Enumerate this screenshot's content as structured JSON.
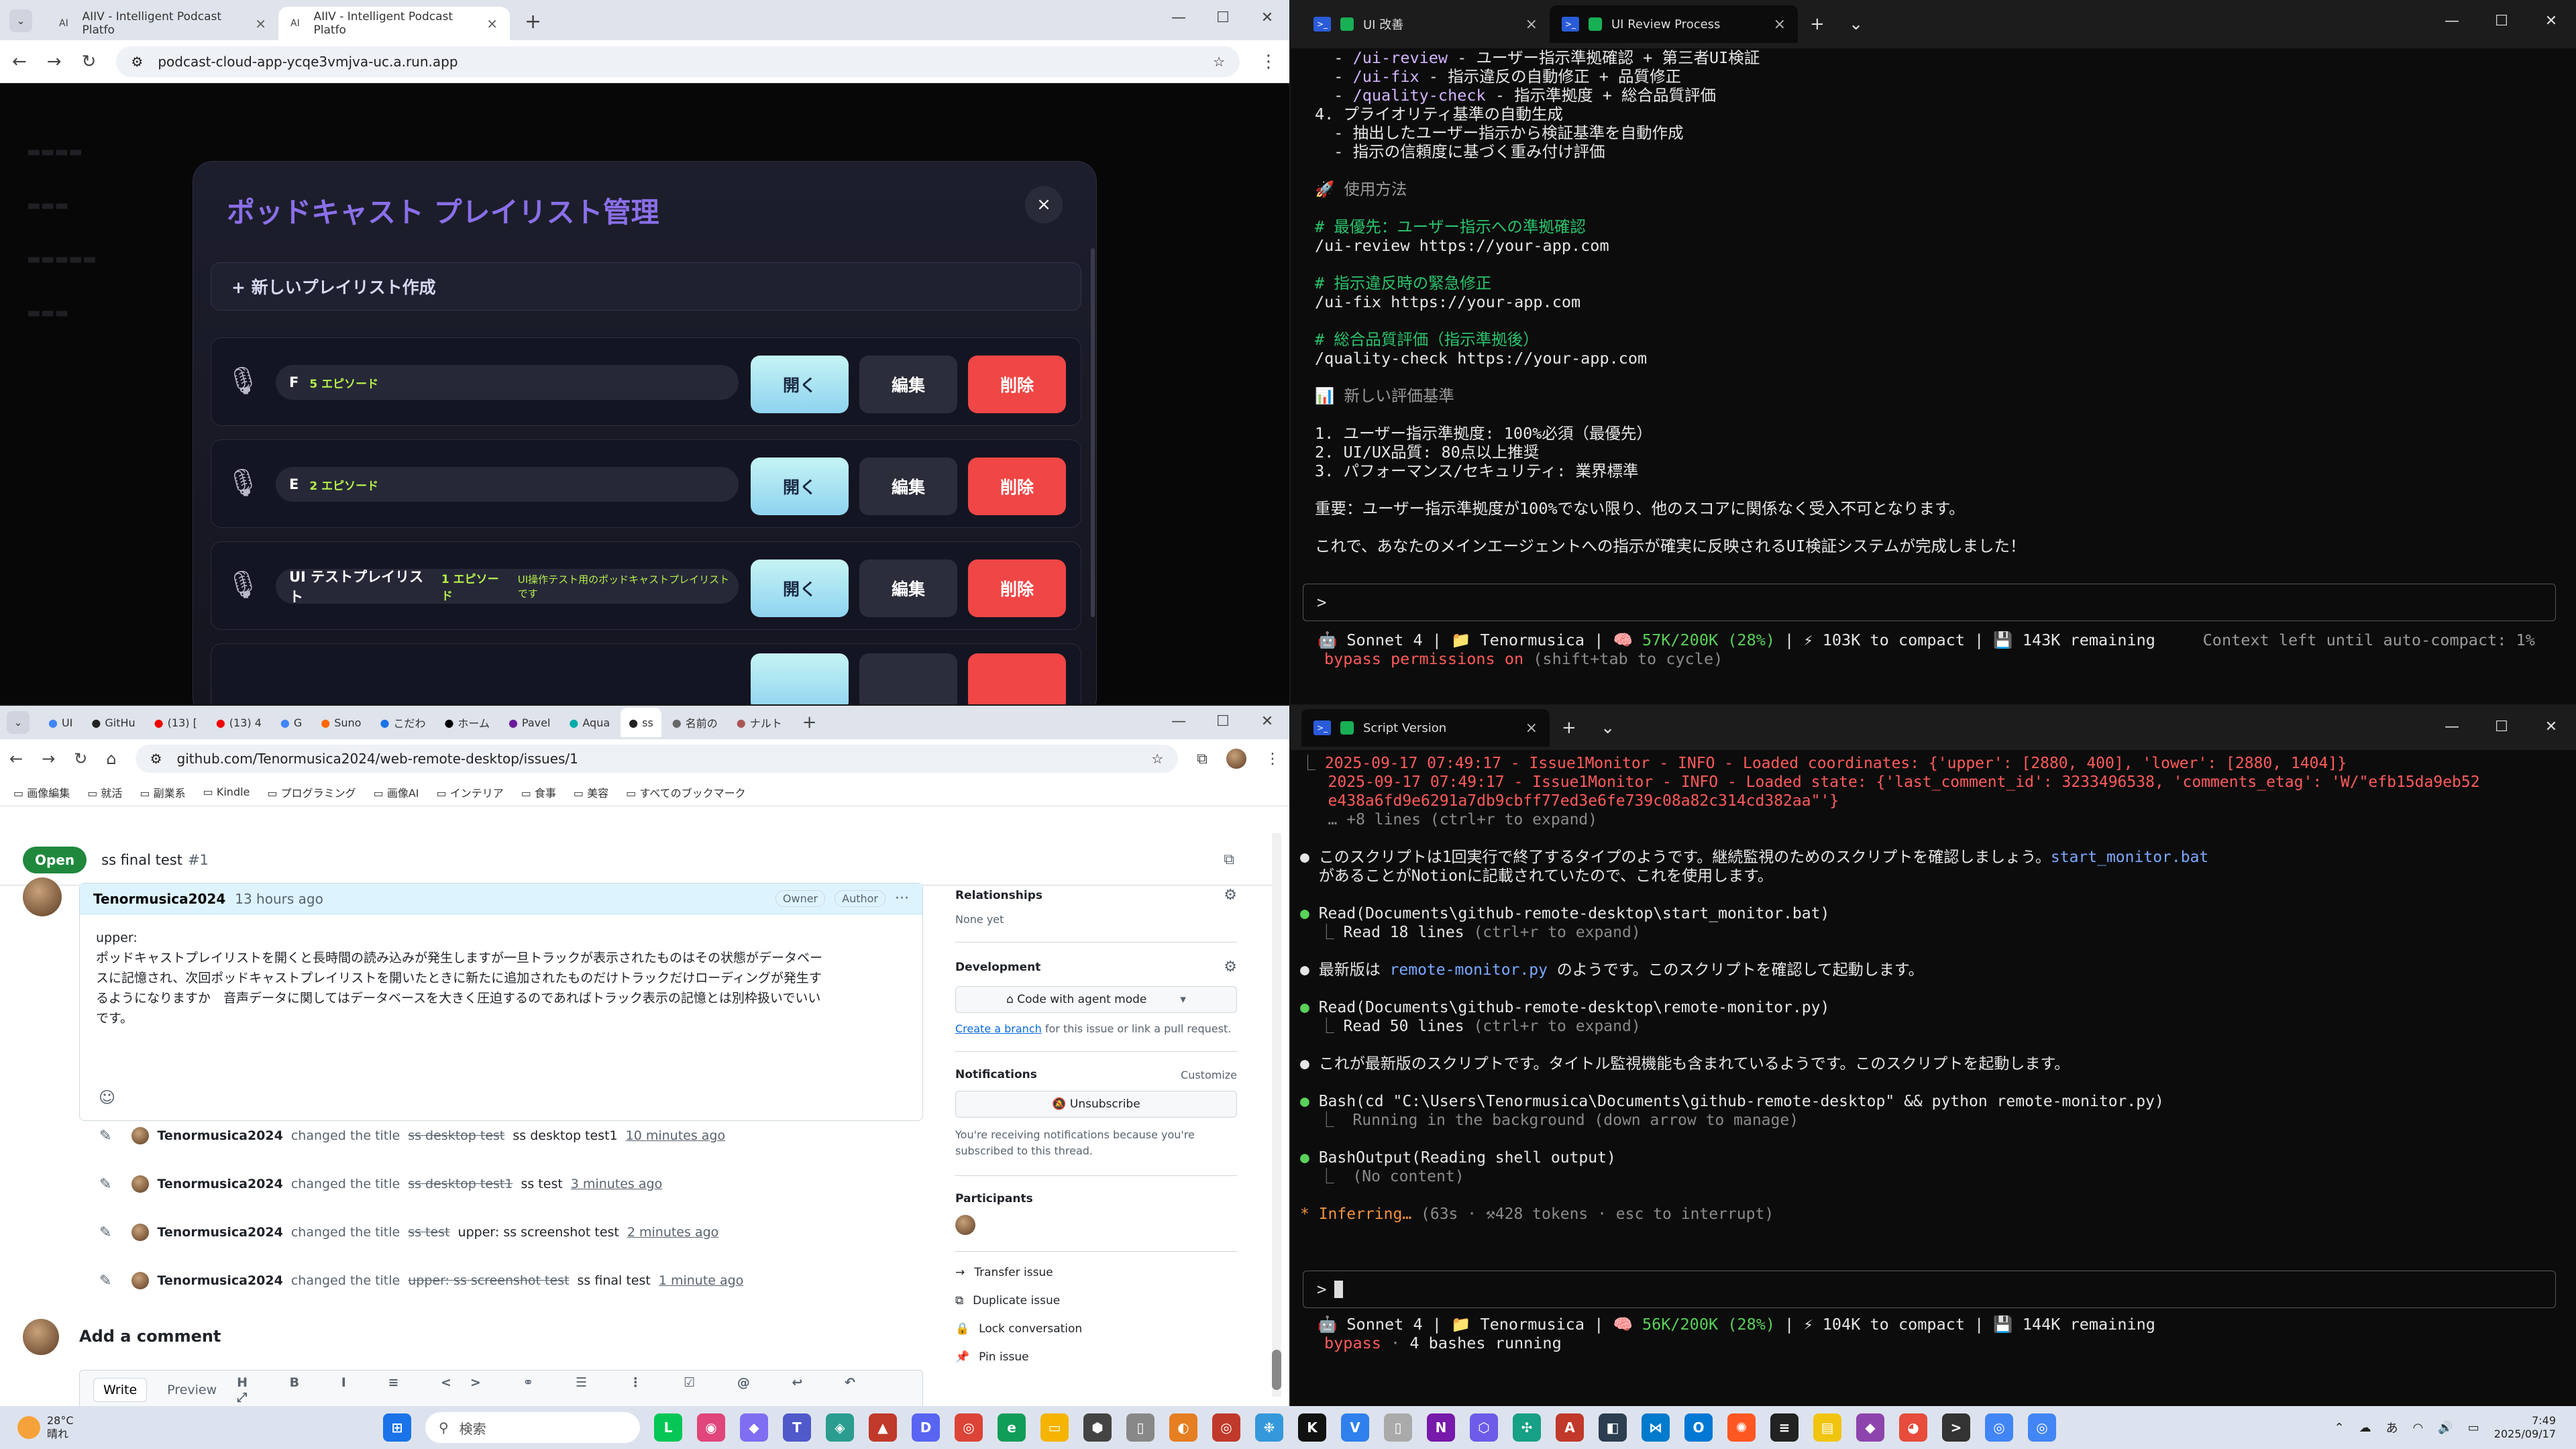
{
  "browser1": {
    "tabs": [
      {
        "icon": "AI",
        "title": "AIIV - Intelligent Podcast Platfo"
      },
      {
        "icon": "AI",
        "title": "AIIV - Intelligent Podcast Platfo"
      }
    ],
    "url": "podcast-cloud-app-ycqe3vmjva-uc.a.run.app",
    "modal": {
      "title": "ポッドキャスト プレイリスト管理",
      "close": "×",
      "new_playlist": "+ 新しいプレイリスト作成",
      "playlists": [
        {
          "name": "F",
          "episodes": "5 エピソード",
          "desc": ""
        },
        {
          "name": "E",
          "episodes": "2 エピソード",
          "desc": ""
        },
        {
          "name": "UI テストプレイリスト",
          "episodes": "1 エピソード",
          "desc": "UI操作テスト用のポッドキャストプレイリストです"
        }
      ],
      "open_label": "開く",
      "edit_label": "編集",
      "delete_label": "削除"
    }
  },
  "term1": {
    "tabs": [
      {
        "title": "UI 改善"
      },
      {
        "title": "UI Review Process"
      }
    ],
    "lines": [
      {
        "cls": "",
        "parts": [
          {
            "c": "",
            "t": "  - "
          },
          {
            "c": "cmd",
            "t": "/ui-review"
          },
          {
            "c": "",
            "t": " - ユーザー指示準拠確認 + 第三者UI検証"
          }
        ]
      },
      {
        "cls": "",
        "parts": [
          {
            "c": "",
            "t": "  - "
          },
          {
            "c": "cmd",
            "t": "/ui-fix"
          },
          {
            "c": "",
            "t": " - 指示違反の自動修正 + 品質修正"
          }
        ]
      },
      {
        "cls": "",
        "parts": [
          {
            "c": "",
            "t": "  - "
          },
          {
            "c": "cmd",
            "t": "/quality-check"
          },
          {
            "c": "",
            "t": " - 指示準拠度 + 総合品質評価"
          }
        ]
      },
      {
        "cls": "",
        "parts": [
          {
            "c": "",
            "t": "4. プライオリティ基準の自動生成"
          }
        ]
      },
      {
        "cls": "",
        "parts": [
          {
            "c": "",
            "t": "  - 抽出したユーザー指示から検証基準を自動作成"
          }
        ]
      },
      {
        "cls": "",
        "parts": [
          {
            "c": "",
            "t": "  - 指示の信頼度に基づく重み付け評価"
          }
        ]
      },
      {
        "cls": "",
        "parts": [
          {
            "c": "",
            "t": ""
          }
        ]
      },
      {
        "cls": "",
        "parts": [
          {
            "c": "",
            "t": "🚀 "
          },
          {
            "c": "gray",
            "t": "使用方法"
          }
        ]
      },
      {
        "cls": "",
        "parts": [
          {
            "c": "",
            "t": ""
          }
        ]
      },
      {
        "cls": "",
        "parts": [
          {
            "c": "cmt",
            "t": "# 最優先：ユーザー指示への準拠確認"
          }
        ]
      },
      {
        "cls": "",
        "parts": [
          {
            "c": "",
            "t": "/ui-review https://your-app.com"
          }
        ]
      },
      {
        "cls": "",
        "parts": [
          {
            "c": "",
            "t": ""
          }
        ]
      },
      {
        "cls": "",
        "parts": [
          {
            "c": "cmt",
            "t": "# 指示違反時の緊急修正"
          }
        ]
      },
      {
        "cls": "",
        "parts": [
          {
            "c": "",
            "t": "/ui-fix https://your-app.com"
          }
        ]
      },
      {
        "cls": "",
        "parts": [
          {
            "c": "",
            "t": ""
          }
        ]
      },
      {
        "cls": "",
        "parts": [
          {
            "c": "cmt",
            "t": "# 総合品質評価（指示準拠後）"
          }
        ]
      },
      {
        "cls": "",
        "parts": [
          {
            "c": "",
            "t": "/quality-check https://your-app.com"
          }
        ]
      },
      {
        "cls": "",
        "parts": [
          {
            "c": "",
            "t": ""
          }
        ]
      },
      {
        "cls": "",
        "parts": [
          {
            "c": "",
            "t": "📊 "
          },
          {
            "c": "gray",
            "t": "新しい評価基準"
          }
        ]
      },
      {
        "cls": "",
        "parts": [
          {
            "c": "",
            "t": ""
          }
        ]
      },
      {
        "cls": "",
        "parts": [
          {
            "c": "",
            "t": "1. ユーザー指示準拠度: 100%必須（最優先）"
          }
        ]
      },
      {
        "cls": "",
        "parts": [
          {
            "c": "",
            "t": "2. UI/UX品質: 80点以上推奨"
          }
        ]
      },
      {
        "cls": "",
        "parts": [
          {
            "c": "",
            "t": "3. パフォーマンス/セキュリティ: 業界標準"
          }
        ]
      },
      {
        "cls": "",
        "parts": [
          {
            "c": "",
            "t": ""
          }
        ]
      },
      {
        "cls": "",
        "parts": [
          {
            "c": "",
            "t": "重要：ユーザー指示準拠度が100%でない限り、他のスコアに関係なく受入不可となります。"
          }
        ]
      },
      {
        "cls": "",
        "parts": [
          {
            "c": "",
            "t": ""
          }
        ]
      },
      {
        "cls": "",
        "parts": [
          {
            "c": "",
            "t": "これで、あなたのメインエージェントへの指示が確実に反映されるUI検証システムが完成しました！"
          }
        ]
      }
    ],
    "prompt": ">",
    "status_parts": [
      {
        "c": "",
        "t": "🤖 Sonnet 4 | 📁 Tenormusica | 🧠 "
      },
      {
        "c": "green",
        "t": "57K/200K (28%)"
      },
      {
        "c": "",
        "t": " | ⚡ 103K to compact | 💾 143K remaining     "
      },
      {
        "c": "gray",
        "t": "Context left until auto-compact: 1%"
      }
    ],
    "mode_parts": [
      {
        "c": "red",
        "t": "bypass permissions on"
      },
      {
        "c": "dim",
        "t": " (shift+tab to cycle)"
      }
    ]
  },
  "browser2": {
    "tabs": [
      "UI",
      "GitHu",
      "(13) [",
      "(13) 4",
      "G",
      "Suno",
      "こだわ",
      "ホーム",
      "Pavel",
      "Aqua",
      "ss",
      "名前の",
      "ナルト"
    ],
    "url": "github.com/Tenormusica2024/web-remote-desktop/issues/1",
    "bookmarks": [
      "画像編集",
      "就活",
      "副業系",
      "Kindle",
      "プログラミング",
      "画像AI",
      "インテリア",
      "食事",
      "美容",
      "すべてのブックマーク"
    ],
    "issue": {
      "state": "Open",
      "title": "ss final test",
      "number": "#1",
      "author": "Tenormusica2024",
      "time": "13 hours ago",
      "owner": "Owner",
      "author_badge": "Author",
      "body_lines": [
        "upper:",
        "ポッドキャストプレイリストを開くと長時間の読み込みが発生しますが一旦トラックが表示されたものはその状態がデータベー",
        "スに記憶され、次回ポッドキャストプレイリストを開いたときに新たに追加されたものだけトラックだけローディングが発生す",
        "るようになりますか　音声データに関してはデータベースを大きく圧迫するのであればトラック表示の記憶とは別枠扱いでいい",
        "です。"
      ],
      "events": [
        {
          "user": "Tenormusica2024",
          "verb": "changed the title",
          "old": "ss desktop test",
          "new": "ss desktop test1",
          "time": "10 minutes ago"
        },
        {
          "user": "Tenormusica2024",
          "verb": "changed the title",
          "old": "ss desktop test1",
          "new": "ss test",
          "time": "3 minutes ago"
        },
        {
          "user": "Tenormusica2024",
          "verb": "changed the title",
          "old": "ss test",
          "new": "upper: ss screenshot test",
          "time": "2 minutes ago"
        },
        {
          "user": "Tenormusica2024",
          "verb": "changed the title",
          "old": "upper: ss screenshot test",
          "new": "ss final test",
          "time": "1 minute ago"
        }
      ],
      "add_comment": "Add a comment",
      "write_tab": "Write",
      "preview_tab": "Preview"
    },
    "sidebar": {
      "relationships": "Relationships",
      "relationships_val": "None yet",
      "development": "Development",
      "code_agent": "Code with agent mode",
      "create_branch": "Create a branch",
      "create_branch_rest": " for this issue or link a pull request.",
      "notifications": "Notifications",
      "customize": "Customize",
      "unsubscribe": "Unsubscribe",
      "notif_note": "You're receiving notifications because you're subscribed to this thread.",
      "participants": "Participants",
      "actions": [
        "Transfer issue",
        "Duplicate issue",
        "Lock conversation",
        "Pin issue"
      ]
    }
  },
  "term2": {
    "tab": "Script Version",
    "lines": [
      {
        "parts": [
          {
            "c": "dim",
            "t": "⎿ "
          },
          {
            "c": "red",
            "t": "2025-09-17 07:49:17 - Issue1Monitor - INFO - Loaded coordinates: {'upper': [2880, 400], 'lower': [2880, 1404]}"
          }
        ]
      },
      {
        "parts": [
          {
            "c": "",
            "t": "   "
          },
          {
            "c": "red",
            "t": "2025-09-17 07:49:17 - Issue1Monitor - INFO - Loaded state: {'last_comment_id': 3233496538, 'comments_etag': 'W/\"efb15da9eb52"
          }
        ]
      },
      {
        "parts": [
          {
            "c": "",
            "t": "   "
          },
          {
            "c": "red",
            "t": "e438a6fd9e6291a7db9cbff77ed3e6fe739c08a82c314cd382aa\"'}"
          }
        ]
      },
      {
        "parts": [
          {
            "c": "",
            "t": "   "
          },
          {
            "c": "dim",
            "t": "… +8 lines (ctrl+r to expand)"
          }
        ]
      },
      {
        "parts": [
          {
            "c": "",
            "t": ""
          }
        ]
      },
      {
        "parts": [
          {
            "c": "",
            "t": "● このスクリプトは1回実行で終了するタイプのようです。継続監視のためのスクリプトを確認しましょう。"
          },
          {
            "c": "blue",
            "t": "start_monitor.bat"
          }
        ]
      },
      {
        "parts": [
          {
            "c": "",
            "t": "  があることがNotionに記載されていたので、これを使用します。"
          }
        ]
      },
      {
        "parts": [
          {
            "c": "",
            "t": ""
          }
        ]
      },
      {
        "parts": [
          {
            "c": "green",
            "t": "● "
          },
          {
            "c": "",
            "t": "Read(Documents\\github-remote-desktop\\start_monitor.bat)"
          }
        ]
      },
      {
        "parts": [
          {
            "c": "dim",
            "t": "  ⎿ "
          },
          {
            "c": "",
            "t": "Read "
          },
          {
            "c": "",
            "t": "18"
          },
          {
            "c": "",
            "t": " lines "
          },
          {
            "c": "dim",
            "t": "(ctrl+r to expand)"
          }
        ]
      },
      {
        "parts": [
          {
            "c": "",
            "t": ""
          }
        ]
      },
      {
        "parts": [
          {
            "c": "",
            "t": "● 最新版は "
          },
          {
            "c": "blue",
            "t": "remote-monitor.py"
          },
          {
            "c": "",
            "t": " のようです。このスクリプトを確認して起動します。"
          }
        ]
      },
      {
        "parts": [
          {
            "c": "",
            "t": ""
          }
        ]
      },
      {
        "parts": [
          {
            "c": "green",
            "t": "● "
          },
          {
            "c": "",
            "t": "Read(Documents\\github-remote-desktop\\remote-monitor.py)"
          }
        ]
      },
      {
        "parts": [
          {
            "c": "dim",
            "t": "  ⎿ "
          },
          {
            "c": "",
            "t": "Read "
          },
          {
            "c": "",
            "t": "50"
          },
          {
            "c": "",
            "t": " lines "
          },
          {
            "c": "dim",
            "t": "(ctrl+r to expand)"
          }
        ]
      },
      {
        "parts": [
          {
            "c": "",
            "t": ""
          }
        ]
      },
      {
        "parts": [
          {
            "c": "",
            "t": "● これが最新版のスクリプトです。タイトル監視機能も含まれているようです。このスクリプトを起動します。"
          }
        ]
      },
      {
        "parts": [
          {
            "c": "",
            "t": ""
          }
        ]
      },
      {
        "parts": [
          {
            "c": "green",
            "t": "● "
          },
          {
            "c": "",
            "t": "Bash(cd \"C:\\Users\\Tenormusica\\Documents\\github-remote-desktop\" && python remote-monitor.py)"
          }
        ]
      },
      {
        "parts": [
          {
            "c": "dim",
            "t": "  ⎿  Running in the background (down arrow to manage)"
          }
        ]
      },
      {
        "parts": [
          {
            "c": "",
            "t": ""
          }
        ]
      },
      {
        "parts": [
          {
            "c": "green",
            "t": "● "
          },
          {
            "c": "",
            "t": "BashOutput(Reading shell output)"
          }
        ]
      },
      {
        "parts": [
          {
            "c": "dim",
            "t": "  ⎿  (No content)"
          }
        ]
      },
      {
        "parts": [
          {
            "c": "",
            "t": ""
          }
        ]
      },
      {
        "parts": [
          {
            "c": "orange",
            "t": "* Inferring… "
          },
          {
            "c": "dim",
            "t": "(63s · ⚒428 tokens · esc to interrupt)"
          }
        ]
      }
    ],
    "prompt": ">",
    "status_parts": [
      {
        "c": "",
        "t": "🤖 Sonnet 4 | 📁 Tenormusica | 🧠 "
      },
      {
        "c": "green",
        "t": "56K/200K (28%)"
      },
      {
        "c": "",
        "t": " | ⚡ 104K to compact | 💾 144K remaining"
      }
    ],
    "mode_parts": [
      {
        "c": "red",
        "t": "bypass"
      },
      {
        "c": "dim",
        "t": " · "
      },
      {
        "c": "",
        "t": "4 bashes running"
      }
    ]
  },
  "taskbar": {
    "weather_temp": "28°C",
    "weather_text": "晴れ",
    "search_placeholder": "検索",
    "time": "7:49",
    "date": "2025/09/17",
    "ime": "あ"
  }
}
